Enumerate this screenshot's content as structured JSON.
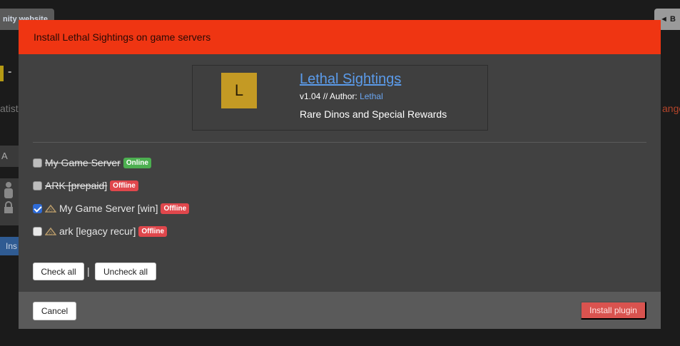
{
  "background": {
    "left_tab": "nity website",
    "right_tab": "B",
    "text_left": "atist",
    "text_right": "ange",
    "box_label": "A",
    "install_fragment": "Ins"
  },
  "modal": {
    "title": "Install Lethal Sightings on game servers",
    "plugin": {
      "logo_letter": "L",
      "name": "Lethal Sightings",
      "version_prefix": "v1.04 // Author: ",
      "author": "Lethal",
      "description": "Rare Dinos and Special Rewards"
    },
    "servers": [
      {
        "name": "My Game Server",
        "status": "Online",
        "checked": false,
        "disabled": true,
        "icon": false
      },
      {
        "name": "ARK [prepaid]",
        "status": "Offline",
        "checked": false,
        "disabled": true,
        "icon": false
      },
      {
        "name": "My Game Server [win]",
        "status": "Offline",
        "checked": true,
        "disabled": false,
        "icon": "ark-icon"
      },
      {
        "name": "ark [legacy recur]",
        "status": "Offline",
        "checked": false,
        "disabled": false,
        "icon": "ark-icon"
      }
    ],
    "check_all": "Check all",
    "separator": "|",
    "uncheck_all": "Uncheck all",
    "cancel": "Cancel",
    "install": "Install plugin"
  },
  "colors": {
    "header": "#ef3512",
    "online": "#4caf50",
    "offline": "#e0474c",
    "link": "#5b9bea",
    "install": "#d9534f"
  }
}
